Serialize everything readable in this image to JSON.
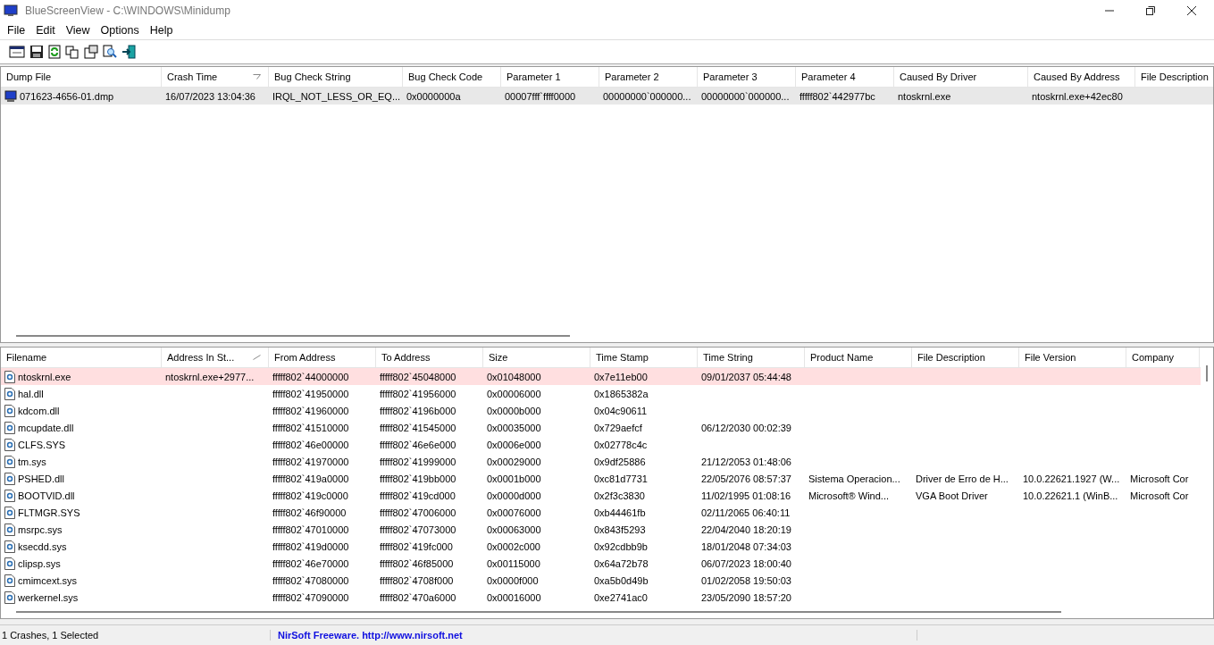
{
  "window": {
    "title": "BlueScreenView  -  C:\\WINDOWS\\Minidump"
  },
  "menu": [
    "File",
    "Edit",
    "View",
    "Options",
    "Help"
  ],
  "crash_list": {
    "columns": [
      {
        "label": "Dump File",
        "sorted": false
      },
      {
        "label": "Crash Time",
        "sorted": true
      },
      {
        "label": "Bug Check String",
        "sorted": false
      },
      {
        "label": "Bug Check Code",
        "sorted": false
      },
      {
        "label": "Parameter 1",
        "sorted": false
      },
      {
        "label": "Parameter 2",
        "sorted": false
      },
      {
        "label": "Parameter 3",
        "sorted": false
      },
      {
        "label": "Parameter 4",
        "sorted": false
      },
      {
        "label": "Caused By Driver",
        "sorted": false
      },
      {
        "label": "Caused By Address",
        "sorted": false
      },
      {
        "label": "File Description",
        "sorted": false
      }
    ],
    "rows": [
      {
        "selected": true,
        "dump_file": "071623-4656-01.dmp",
        "crash_time": "16/07/2023 13:04:36",
        "bug_check_string": "IRQL_NOT_LESS_OR_EQ...",
        "bug_check_code": "0x0000000a",
        "parameter_1": "00007fff`ffff0000",
        "parameter_2": "00000000`000000...",
        "parameter_3": "00000000`000000...",
        "parameter_4": "fffff802`442977bc",
        "caused_by_driver": "ntoskrnl.exe",
        "caused_by_address": "ntoskrnl.exe+42ec80"
      }
    ]
  },
  "driver_list": {
    "columns": [
      {
        "label": "Filename",
        "sorted": false
      },
      {
        "label": "Address In St...",
        "sorted": true
      },
      {
        "label": "From Address",
        "sorted": false
      },
      {
        "label": "To Address",
        "sorted": false
      },
      {
        "label": "Size",
        "sorted": false
      },
      {
        "label": "Time Stamp",
        "sorted": false
      },
      {
        "label": "Time String",
        "sorted": false
      },
      {
        "label": "Product Name",
        "sorted": false
      },
      {
        "label": "File Description",
        "sorted": false
      },
      {
        "label": "File Version",
        "sorted": false
      },
      {
        "label": "Company",
        "sorted": false
      }
    ],
    "rows": [
      {
        "in_stack": true,
        "filename": "ntoskrnl.exe",
        "address_in_stack": "ntoskrnl.exe+2977...",
        "from_address": "fffff802`44000000",
        "to_address": "fffff802`45048000",
        "size": "0x01048000",
        "time_stamp": "0x7e11eb00",
        "time_string": "09/01/2037 05:44:48"
      },
      {
        "in_stack": false,
        "filename": "hal.dll",
        "from_address": "fffff802`41950000",
        "to_address": "fffff802`41956000",
        "size": "0x00006000",
        "time_stamp": "0x1865382a"
      },
      {
        "in_stack": false,
        "filename": "kdcom.dll",
        "from_address": "fffff802`41960000",
        "to_address": "fffff802`4196b000",
        "size": "0x0000b000",
        "time_stamp": "0x04c90611"
      },
      {
        "in_stack": false,
        "filename": "mcupdate.dll",
        "from_address": "fffff802`41510000",
        "to_address": "fffff802`41545000",
        "size": "0x00035000",
        "time_stamp": "0x729aefcf",
        "time_string": "06/12/2030 00:02:39"
      },
      {
        "in_stack": false,
        "filename": "CLFS.SYS",
        "from_address": "fffff802`46e00000",
        "to_address": "fffff802`46e6e000",
        "size": "0x0006e000",
        "time_stamp": "0x02778c4c"
      },
      {
        "in_stack": false,
        "filename": "tm.sys",
        "from_address": "fffff802`41970000",
        "to_address": "fffff802`41999000",
        "size": "0x00029000",
        "time_stamp": "0x9df25886",
        "time_string": "21/12/2053 01:48:06"
      },
      {
        "in_stack": false,
        "filename": "PSHED.dll",
        "from_address": "fffff802`419a0000",
        "to_address": "fffff802`419bb000",
        "size": "0x0001b000",
        "time_stamp": "0xc81d7731",
        "time_string": "22/05/2076 08:57:37",
        "product_name": "Sistema Operacion...",
        "file_description": "Driver de Erro de H...",
        "file_version": "10.0.22621.1927 (W...",
        "company": "Microsoft Cor"
      },
      {
        "in_stack": false,
        "filename": "BOOTVID.dll",
        "from_address": "fffff802`419c0000",
        "to_address": "fffff802`419cd000",
        "size": "0x0000d000",
        "time_stamp": "0x2f3c3830",
        "time_string": "11/02/1995 01:08:16",
        "product_name": "Microsoft® Wind...",
        "file_description": "VGA Boot Driver",
        "file_version": "10.0.22621.1 (WinB...",
        "company": "Microsoft Cor"
      },
      {
        "in_stack": false,
        "filename": "FLTMGR.SYS",
        "from_address": "fffff802`46f90000",
        "to_address": "fffff802`47006000",
        "size": "0x00076000",
        "time_stamp": "0xb44461fb",
        "time_string": "02/11/2065 06:40:11"
      },
      {
        "in_stack": false,
        "filename": "msrpc.sys",
        "from_address": "fffff802`47010000",
        "to_address": "fffff802`47073000",
        "size": "0x00063000",
        "time_stamp": "0x843f5293",
        "time_string": "22/04/2040 18:20:19"
      },
      {
        "in_stack": false,
        "filename": "ksecdd.sys",
        "from_address": "fffff802`419d0000",
        "to_address": "fffff802`419fc000",
        "size": "0x0002c000",
        "time_stamp": "0x92cdbb9b",
        "time_string": "18/01/2048 07:34:03"
      },
      {
        "in_stack": false,
        "filename": "clipsp.sys",
        "from_address": "fffff802`46e70000",
        "to_address": "fffff802`46f85000",
        "size": "0x00115000",
        "time_stamp": "0x64a72b78",
        "time_string": "06/07/2023 18:00:40"
      },
      {
        "in_stack": false,
        "filename": "cmimcext.sys",
        "from_address": "fffff802`47080000",
        "to_address": "fffff802`4708f000",
        "size": "0x0000f000",
        "time_stamp": "0xa5b0d49b",
        "time_string": "01/02/2058 19:50:03"
      },
      {
        "in_stack": false,
        "filename": "werkernel.sys",
        "from_address": "fffff802`47090000",
        "to_address": "fffff802`470a6000",
        "size": "0x00016000",
        "time_stamp": "0xe2741ac0",
        "time_string": "23/05/2090 18:57:20"
      }
    ]
  },
  "status_bar": {
    "count": "1 Crashes, 1 Selected",
    "credit": "NirSoft Freeware.  http://www.nirsoft.net"
  }
}
